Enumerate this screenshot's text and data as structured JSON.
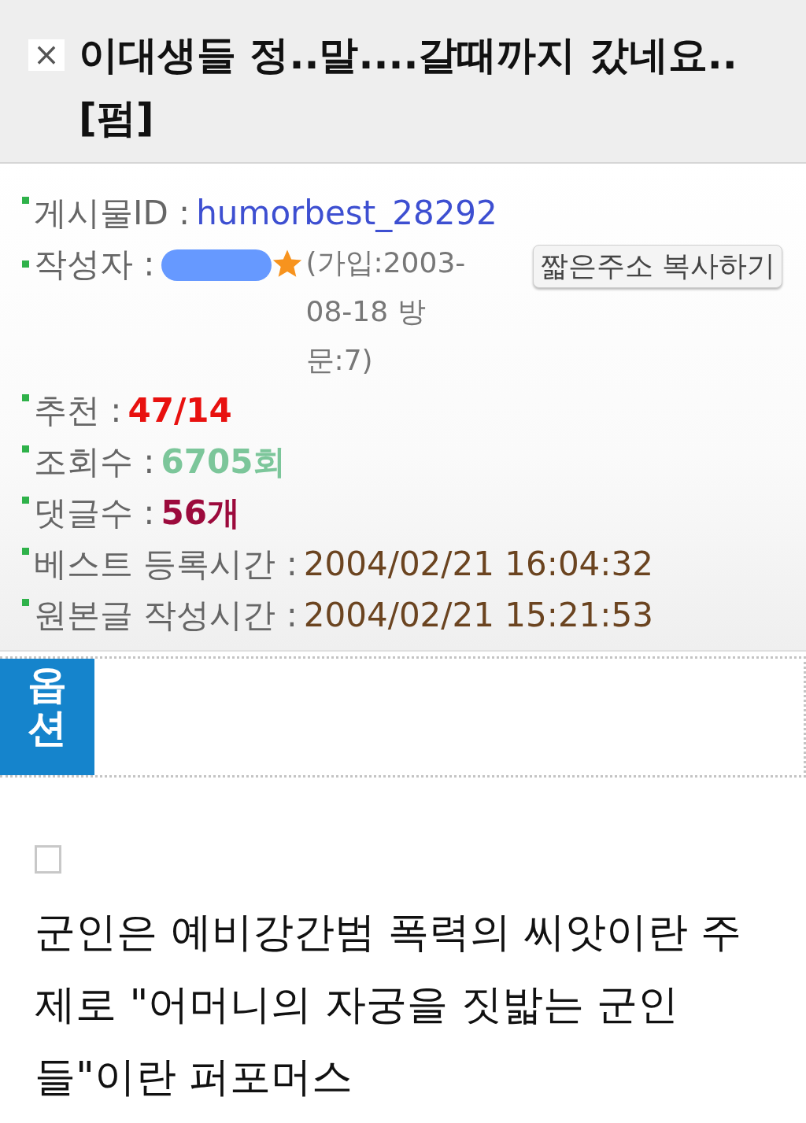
{
  "title": {
    "icon_text": "×",
    "text": "이대생들 정..말....갈때까지 갔네요..[펌]"
  },
  "info_rows": [
    {
      "kind": "id",
      "label": "게시물ID :",
      "value": "humorbest_28292"
    },
    {
      "kind": "author",
      "label": "작성자 :",
      "join_info": "(가입:2003-08-18 방문:7)",
      "button": "짧은주소 복사하기"
    },
    {
      "kind": "recommend",
      "label": "추천 :",
      "value": "47/14"
    },
    {
      "kind": "views",
      "label": "조회수 :",
      "value": "6705회"
    },
    {
      "kind": "comments",
      "label": "댓글수 :",
      "value": "56개"
    },
    {
      "kind": "time",
      "label": "베스트 등록시간 :",
      "value": "2004/02/21 16:04:32"
    },
    {
      "kind": "time",
      "label": "원본글 작성시간 :",
      "value": "2004/02/21 15:21:53"
    }
  ],
  "options_tab": "옵션",
  "body": "군인은 예비강간범 폭력의 씨앗이란 주제로 \"어머니의 자궁을 짓밟는 군인들\"이란 퍼포머스"
}
